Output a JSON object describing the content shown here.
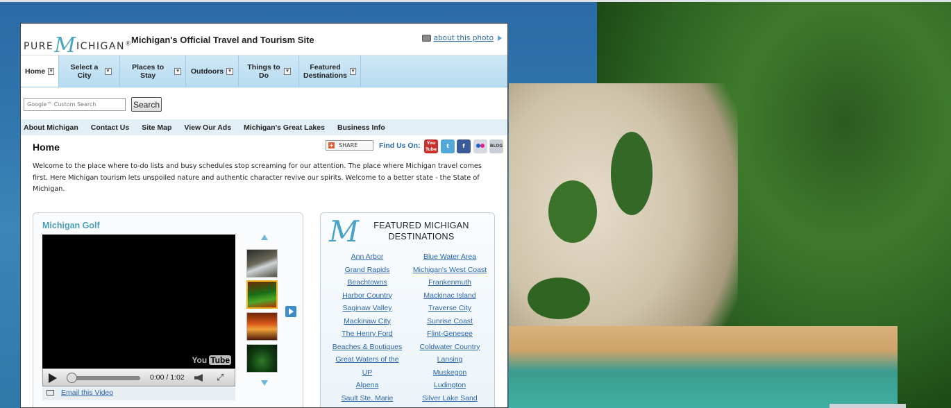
{
  "header": {
    "logo_text_left": "PURE",
    "logo_m": "M",
    "logo_text_right": "ICHIGAN",
    "logo_reg": "®",
    "site_title": "Michigan's Official Travel and Tourism Site",
    "about_photo": "about this photo"
  },
  "nav": {
    "items": [
      {
        "label": "Home",
        "active": true
      },
      {
        "label": "Select a City"
      },
      {
        "label": "Places to Stay"
      },
      {
        "label": "Outdoors"
      },
      {
        "label": "Things to Do"
      },
      {
        "label": "Featured Destinations"
      }
    ],
    "dropdown_glyph": "▾"
  },
  "search": {
    "placeholder": "Google™ Custom Search",
    "button_label": "Search"
  },
  "subnav": {
    "items": [
      "About Michigan",
      "Contact Us",
      "Site Map",
      "View Our Ads",
      "Michigan's Great Lakes",
      "Business Info"
    ]
  },
  "main": {
    "page_title": "Home",
    "share_label": "SHARE",
    "find_us_label": "Find Us On:",
    "social": [
      "You Tube",
      "Twitter",
      "Facebook",
      "Flickr",
      "BLOG"
    ],
    "intro": "Welcome to the place where to-do lists and busy schedules stop screaming for our attention. The place where Michigan travel comes first. Here Michigan tourism lets unspoiled nature and authentic character revive our spirits. Welcome to a better state - the State of Michigan."
  },
  "video": {
    "title": "Michigan Golf",
    "yt_label_a": "You",
    "yt_label_b": "Tube",
    "time": "0:00 / 1:02",
    "email_label": "Email this Video"
  },
  "destinations": {
    "title": "FEATURED MICHIGAN DESTINATIONS",
    "left": [
      "Ann Arbor",
      "Grand Rapids",
      "Beachtowns",
      "Harbor Country",
      "Saginaw Valley",
      "Mackinaw City",
      "The Henry Ford",
      "Beaches & Boutiques",
      "Great Waters of the UP",
      "Alpena",
      "Sault Ste. Marie"
    ],
    "right": [
      "Blue Water Area",
      "Michigan's West Coast",
      "Frankenmuth",
      "Mackinac Island",
      "Traverse City",
      "Sunrise Coast",
      "Flint-Genesee",
      "Coldwater Country",
      "Lansing",
      "Muskegon",
      "Ludington",
      "Silver Lake Sand"
    ]
  }
}
